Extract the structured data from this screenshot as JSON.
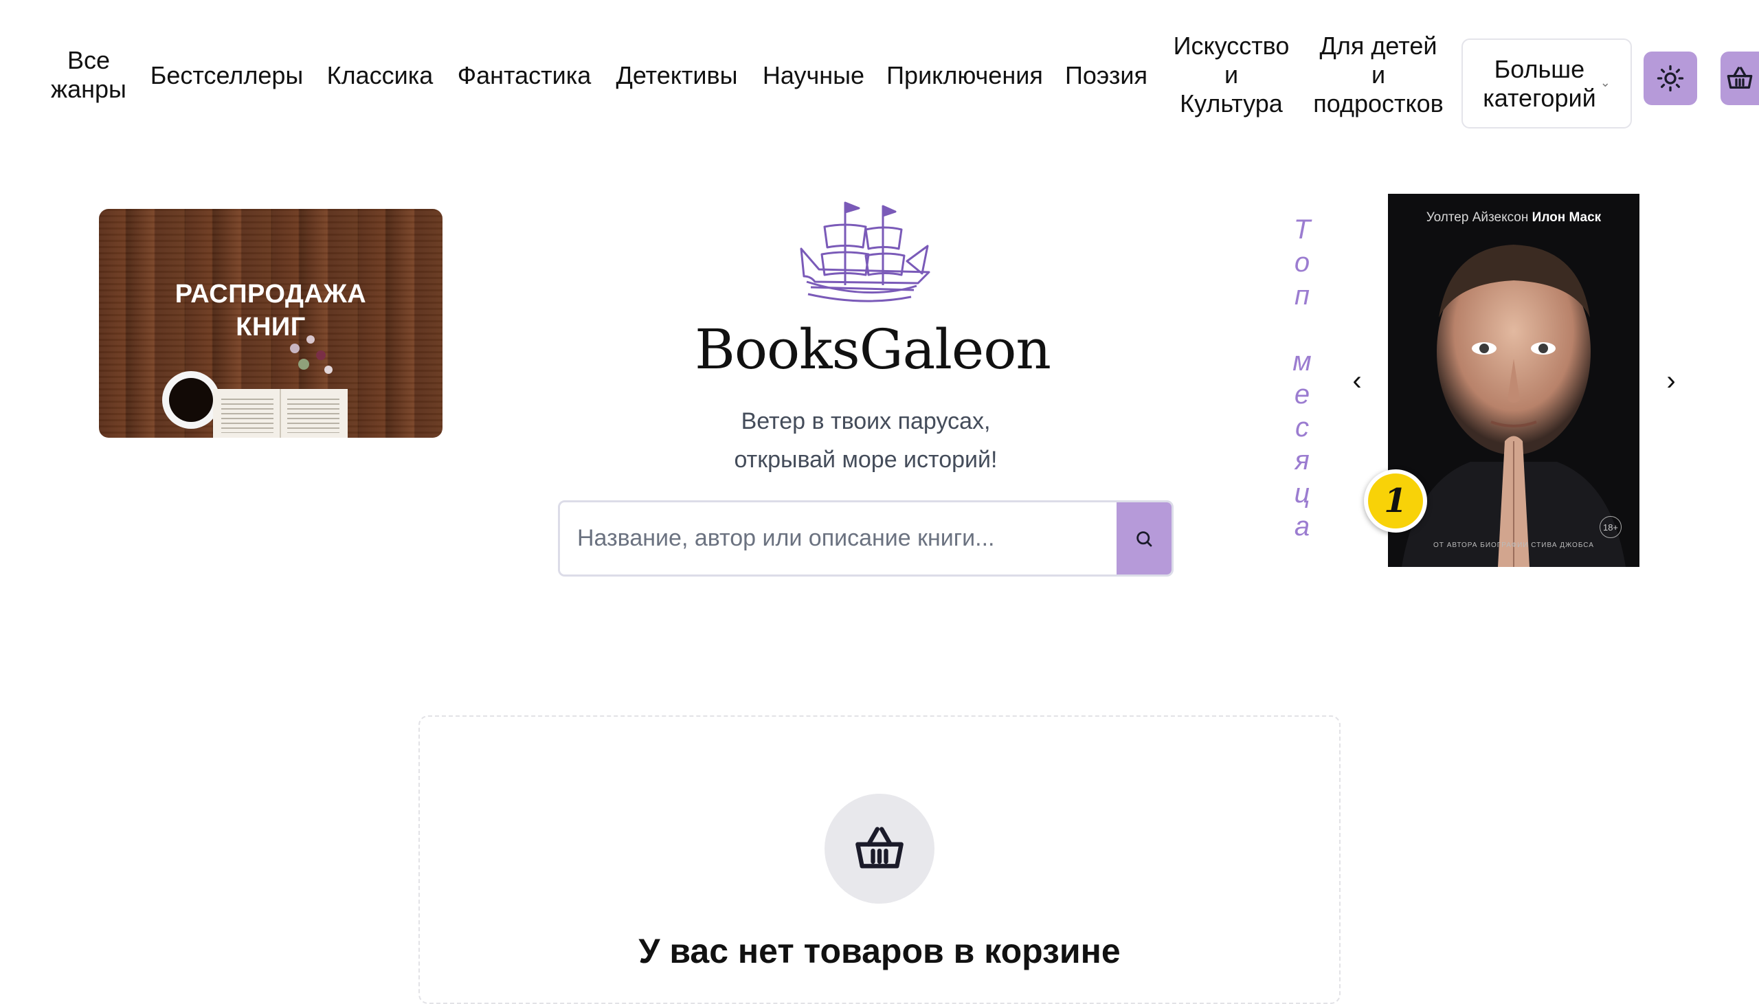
{
  "nav": {
    "links": [
      {
        "label": "Все\nжанры"
      },
      {
        "label": "Бестселлеры"
      },
      {
        "label": "Классика"
      },
      {
        "label": "Фантастика"
      },
      {
        "label": "Детективы"
      },
      {
        "label": "Научные"
      },
      {
        "label": "Приключения"
      },
      {
        "label": "Поэзия"
      },
      {
        "label": "Искусство\nи\nКультура"
      },
      {
        "label": "Для детей\nи\nподростков"
      }
    ],
    "more_label": "Больше\nкатегорий",
    "theme_icon": "sun-icon",
    "cart_icon": "basket-icon",
    "accent_color": "#b69ad9"
  },
  "sale_banner": {
    "title": "РАСПРОДАЖА\nКНИГ"
  },
  "brand": {
    "name": "BooksGaleon",
    "tagline": "Ветер в твоих парусах,\nоткрывай море историй!",
    "logo_icon": "galleon-ship-icon"
  },
  "search": {
    "placeholder": "Название, автор или описание книги..."
  },
  "top_month": {
    "vertical_letters": [
      "Т",
      "о",
      "п",
      " ",
      "м",
      "е",
      "с",
      "я",
      "ц",
      "а"
    ],
    "book": {
      "author": "Уолтер Айзексон",
      "title": "Илон Маск",
      "foot_text": "ОТ АВТОРА БИОГРАФИИ СТИВА ДЖОБСА",
      "age_rating": "18+"
    },
    "rank": "1",
    "prev_arrow": "‹",
    "next_arrow": "›"
  },
  "cart": {
    "empty_text": "У вас нет товаров в корзине"
  }
}
